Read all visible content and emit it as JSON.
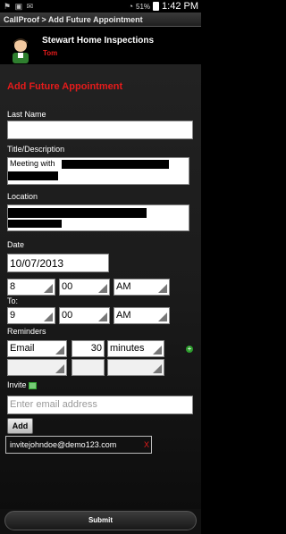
{
  "status_bar": {
    "battery_pct": "51%",
    "time": "1:42 PM"
  },
  "title_bar": "CallProof > Add Future Appointment",
  "header": {
    "company": "Stewart Home Inspections",
    "user": "Tom"
  },
  "form": {
    "section_title": "Add Future Appointment",
    "last_name": {
      "label": "Last Name",
      "value": ""
    },
    "title": {
      "label": "Title/Description",
      "value": "Meeting with"
    },
    "location": {
      "label": "Location",
      "value": ""
    },
    "date": {
      "label": "Date",
      "value": "10/07/2013"
    },
    "start": {
      "hour": "8",
      "minute": "00",
      "ampm": "AM"
    },
    "end": {
      "label": "To:",
      "hour": "9",
      "minute": "00",
      "ampm": "AM"
    },
    "reminders": {
      "label": "Reminders",
      "type": "Email",
      "amount": "30",
      "unit": "minutes"
    },
    "invite": {
      "label": "Invite",
      "placeholder": "Enter email address",
      "add_label": "Add",
      "invitee": "invitejohndoe@demo123.com",
      "remove_label": "X"
    }
  },
  "submit_label": "Submit",
  "colors": {
    "accent_red": "#e51b1b",
    "background": "#000000",
    "plus_green": "#2d9e2d"
  }
}
